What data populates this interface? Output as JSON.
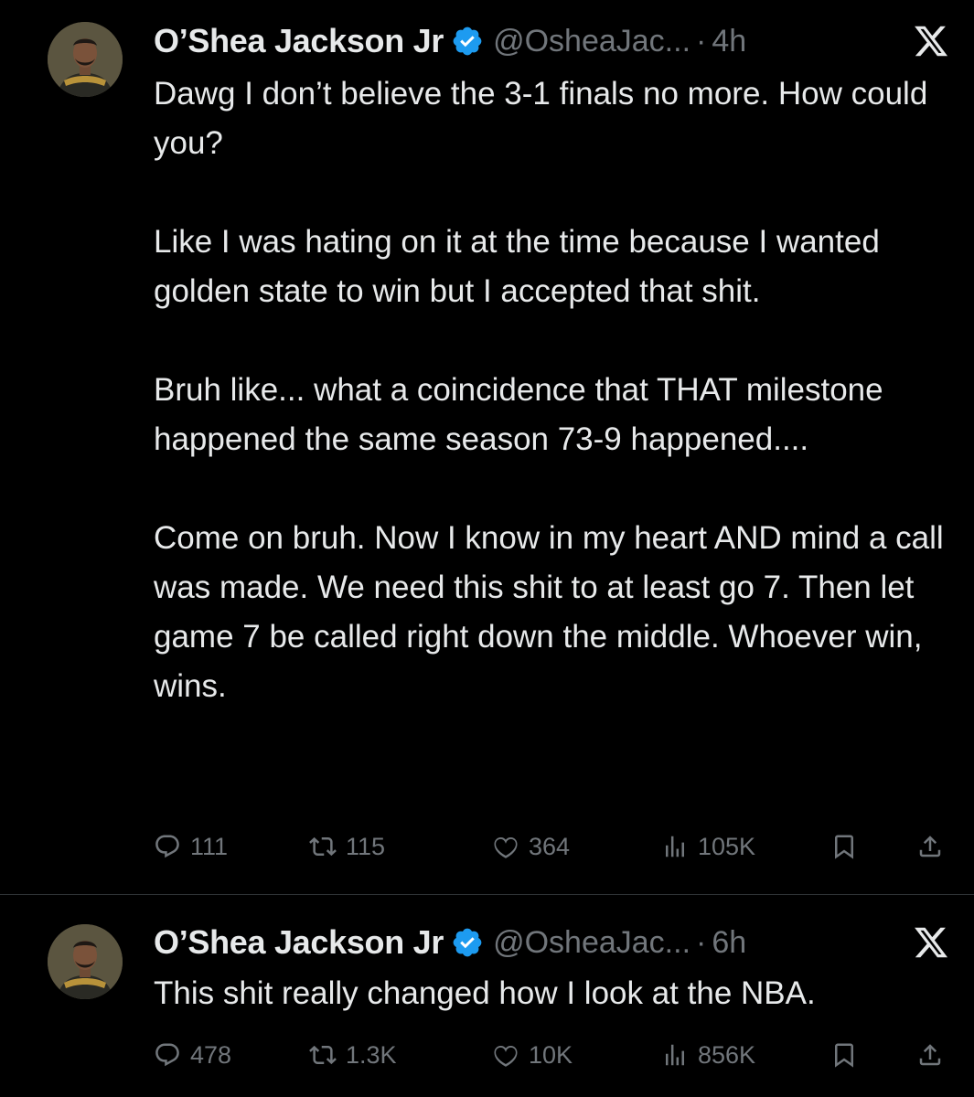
{
  "tweets": [
    {
      "author_name": "O’Shea Jackson Jr",
      "handle": "@OsheaJac...",
      "separator": "·",
      "time": "4h",
      "paragraphs": [
        "Dawg I don’t believe the 3-1 finals no more. How could you?",
        "Like I was hating on it at the time because I wanted golden state to win but I accepted that shit.",
        "Bruh like... what a coincidence that THAT milestone happened the same season 73-9 happened....",
        "Come on bruh. Now I know in my heart AND mind a call was made.  We need this shit to at least go 7. Then let game 7 be called right down the middle. Whoever win, wins."
      ],
      "stats": {
        "replies": "111",
        "reposts": "115",
        "likes": "364",
        "views": "105K"
      }
    },
    {
      "author_name": "O’Shea Jackson Jr",
      "handle": "@OsheaJac...",
      "separator": "·",
      "time": "6h",
      "paragraphs": [
        "This shit really changed how I look at the NBA."
      ],
      "stats": {
        "replies": "478",
        "reposts": "1.3K",
        "likes": "10K",
        "views": "856K"
      }
    }
  ],
  "icons": {
    "verified": "verified-badge-icon",
    "platform": "x-logo-icon",
    "reply": "reply-icon",
    "repost": "repost-icon",
    "like": "heart-icon",
    "views": "views-chart-icon",
    "bookmark": "bookmark-icon",
    "share": "share-icon"
  },
  "colors": {
    "background": "#000000",
    "text": "#e7e9ea",
    "secondary": "#71767b",
    "verified": "#1d9bf0",
    "divider": "#2f3336"
  }
}
